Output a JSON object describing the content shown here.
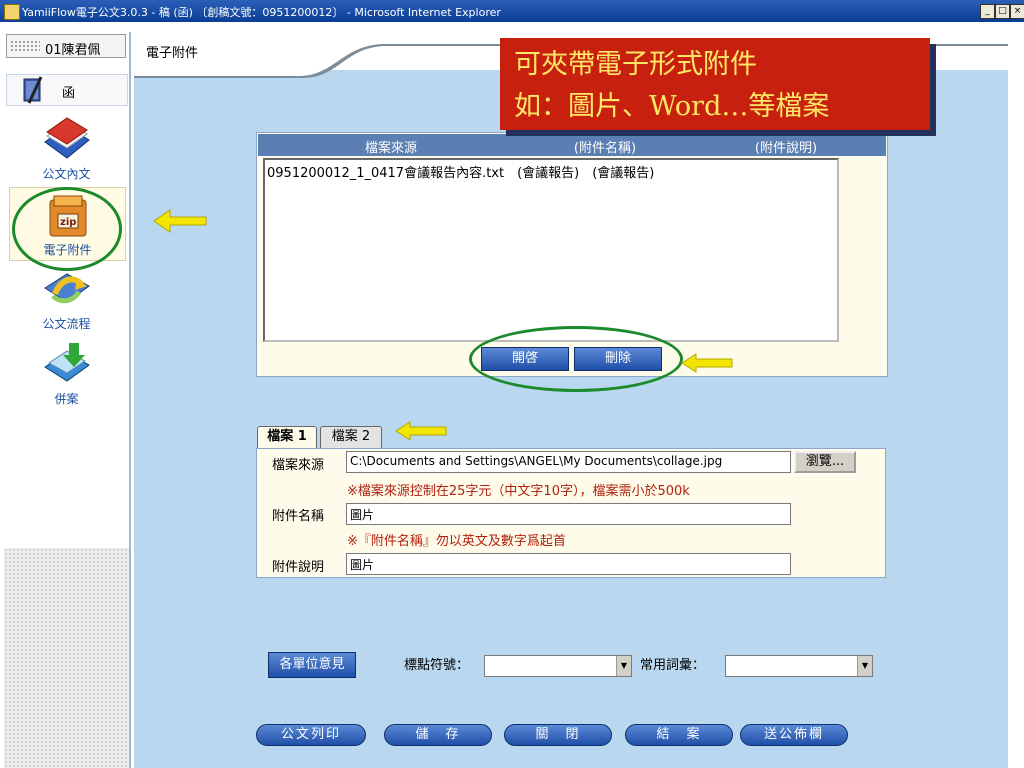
{
  "window": {
    "title": "YamiiFlow電子公文3.0.3 - 稿 (函) 〔創稿文號：0951200012〕 - Microsoft Internet Explorer"
  },
  "sidebar": {
    "user": "01陳君佩",
    "doc_type": "函",
    "items": [
      {
        "label": "公文內文",
        "icon": "document-stack-icon"
      },
      {
        "label": "電子附件",
        "icon": "zip-folder-icon"
      },
      {
        "label": "公文流程",
        "icon": "flow-arrows-icon"
      },
      {
        "label": "併案",
        "icon": "merge-download-icon"
      }
    ]
  },
  "main": {
    "heading": "電子附件",
    "callout": {
      "line1": "可夾帶電子形式附件",
      "line2": "如：圖片、Word…等檔案"
    },
    "attachment_list": {
      "columns": [
        "檔案來源",
        "(附件名稱)",
        "(附件說明)"
      ],
      "rows": [
        "0951200012_1_0417會議報告內容.txt　(會議報告)　(會議報告)"
      ]
    },
    "open_button": "開啓",
    "delete_button": "刪除",
    "tabs": [
      "檔案 1",
      "檔案 2"
    ],
    "form": {
      "source_label": "檔案來源",
      "source_value": "C:\\Documents and Settings\\ANGEL\\My Documents\\collage.jpg",
      "browse_button": "瀏覽...",
      "source_note": "※檔案來源控制在25字元（中文字10字），檔案需小於500k",
      "name_label": "附件名稱",
      "name_value": "圖片",
      "name_note": "※『附件名稱』勿以英文及數字爲起首",
      "desc_label": "附件說明",
      "desc_value": "圖片"
    },
    "opinion_button": "各單位意見",
    "punctuation_label": "標點符號：",
    "phrases_label": "常用詞彙：",
    "bottom_buttons": [
      "公文列印",
      "儲　存",
      "關　閉",
      "結　案",
      "送公佈欄"
    ]
  },
  "colors": {
    "callout_bg": "#c8200e",
    "callout_text": "#ffe766",
    "content_bg": "#b9d7ee",
    "highlight_ellipse": "#1b8a2a",
    "pointer_arrow": "#f2e600"
  }
}
